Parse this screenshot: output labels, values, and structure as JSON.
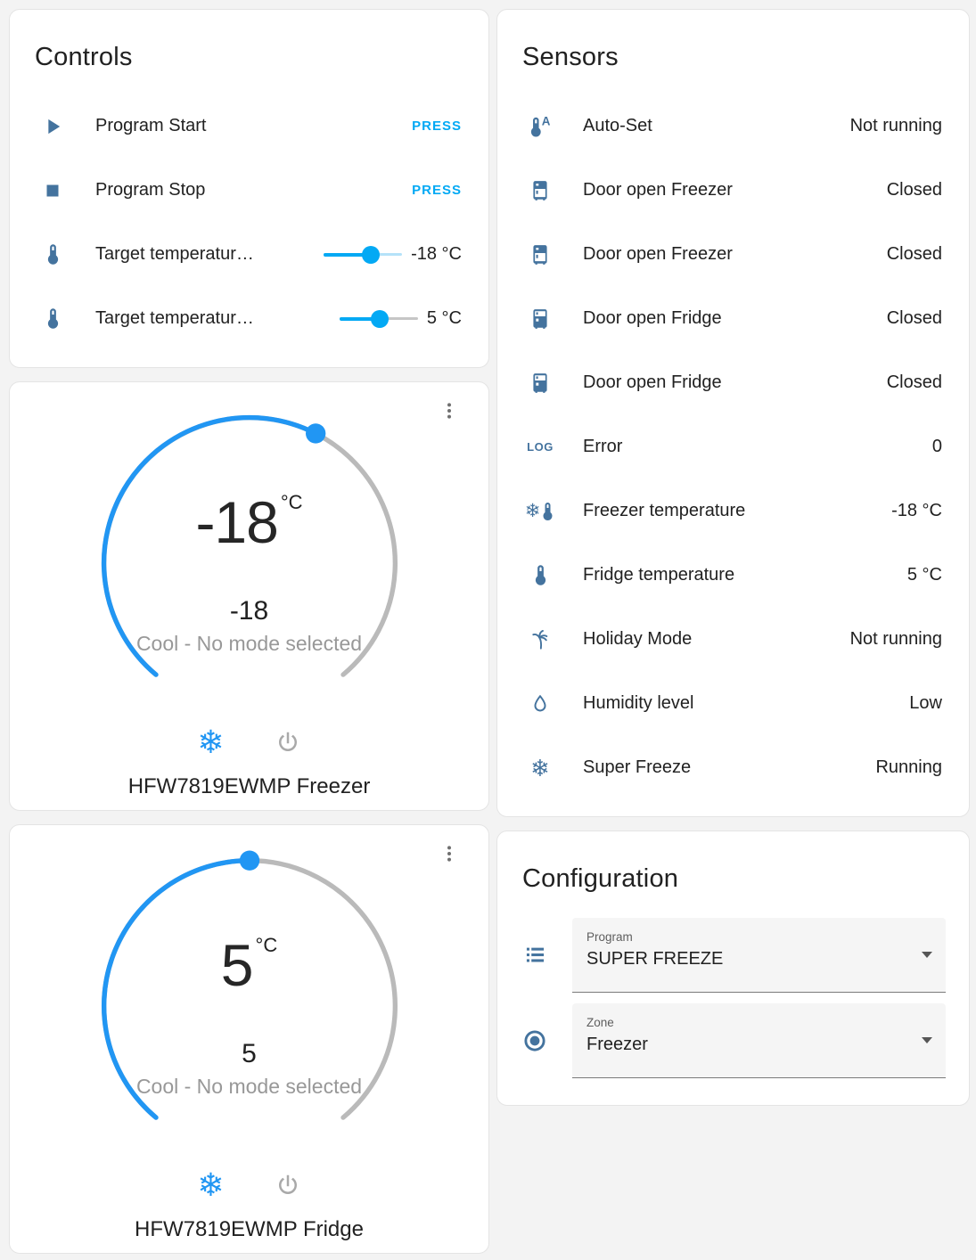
{
  "colors": {
    "accent": "#03a9f4",
    "dial_blue": "#2196f3",
    "icon_blue": "#44739e",
    "dial_gray": "#bababa"
  },
  "controls": {
    "title": "Controls",
    "rows": [
      {
        "icon": "play-icon",
        "label": "Program Start",
        "action": "PRESS"
      },
      {
        "icon": "stop-icon",
        "label": "Program Stop",
        "action": "PRESS"
      },
      {
        "icon": "thermometer-icon",
        "label": "Target temperatur…",
        "value": "-18 °C",
        "slider_pct": 60,
        "slider_rest_color": "#b5e2f9"
      },
      {
        "icon": "thermometer-icon",
        "label": "Target temperatur…",
        "value": "5 °C",
        "slider_pct": 51,
        "slider_rest_color": "#c6c6c6"
      }
    ]
  },
  "sensors": {
    "title": "Sensors",
    "rows": [
      {
        "icon": "thermometer-auto-icon",
        "label": "Auto-Set",
        "value": "Not running"
      },
      {
        "icon": "fridge-top-icon",
        "label": "Door open Freezer",
        "value": "Closed"
      },
      {
        "icon": "fridge-top-icon",
        "label": "Door open Freezer",
        "value": "Closed"
      },
      {
        "icon": "fridge-bottom-icon",
        "label": "Door open Fridge",
        "value": "Closed"
      },
      {
        "icon": "fridge-bottom-icon",
        "label": "Door open Fridge",
        "value": "Closed"
      },
      {
        "icon": "log-icon",
        "label": "Error",
        "value": "0"
      },
      {
        "icon": "snowflake-thermometer-icon",
        "label": "Freezer temperature",
        "value": "-18 °C"
      },
      {
        "icon": "thermometer-icon",
        "label": "Fridge temperature",
        "value": "5 °C"
      },
      {
        "icon": "palm-tree-icon",
        "label": "Holiday Mode",
        "value": "Not running"
      },
      {
        "icon": "water-drop-icon",
        "label": "Humidity level",
        "value": "Low"
      },
      {
        "icon": "snowflake-icon",
        "label": "Super Freeze",
        "value": "Running"
      }
    ]
  },
  "dials": [
    {
      "value": "-18",
      "unit": "°C",
      "secondary": "-18",
      "status": "Cool - No mode selected",
      "device": "HFW7819EWMP Freezer",
      "handle_deg": 27,
      "arc_start_deg": -140,
      "arc_end_deg": 140
    },
    {
      "value": "5",
      "unit": "°C",
      "secondary": "5",
      "status": "Cool - No mode selected",
      "device": "HFW7819EWMP Fridge",
      "handle_deg": 0,
      "arc_start_deg": -140,
      "arc_end_deg": 140
    }
  ],
  "configuration": {
    "title": "Configuration",
    "fields": [
      {
        "icon": "list-icon",
        "label": "Program",
        "value": "SUPER FREEZE"
      },
      {
        "icon": "radiobox-icon",
        "label": "Zone",
        "value": "Freezer"
      }
    ]
  }
}
